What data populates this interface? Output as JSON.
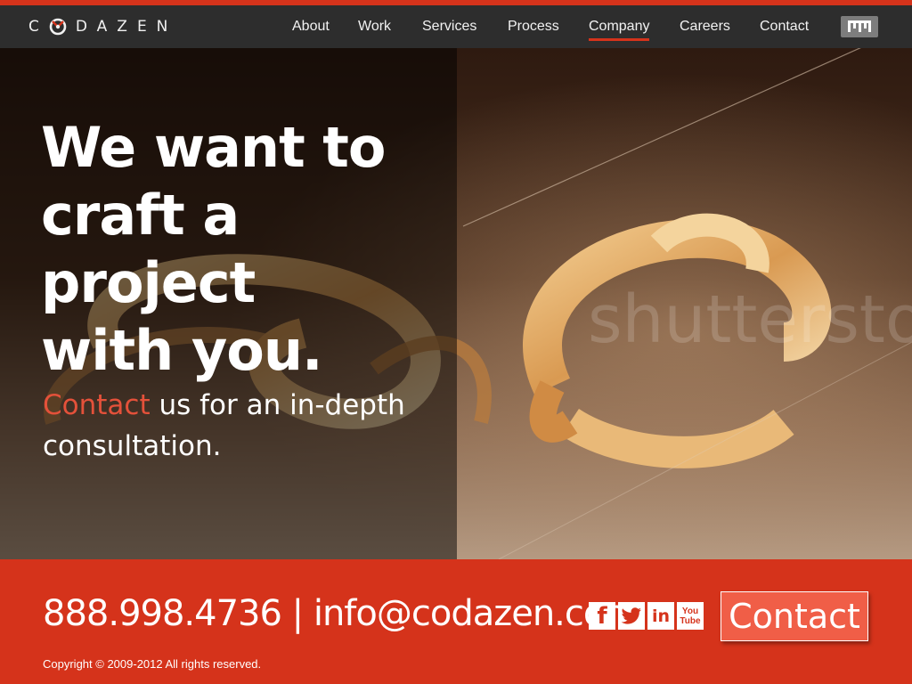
{
  "brand": {
    "name": "CODAZEN",
    "name_after_mark": "DAZEN",
    "name_before_mark": "C",
    "accent": "#d5331b"
  },
  "nav": {
    "items": [
      {
        "label": "About"
      },
      {
        "label": "Work"
      },
      {
        "label": "Services"
      },
      {
        "label": "Process"
      },
      {
        "label": "Company",
        "active": true
      },
      {
        "label": "Careers"
      },
      {
        "label": "Contact"
      }
    ],
    "badge_icon": "comb-icon"
  },
  "hero": {
    "headline_lines": [
      "We want to",
      "craft a project",
      "with you."
    ],
    "sub_accent": "Contact",
    "sub_rest": " us for an in-depth consultation.",
    "watermark": "shutterstock"
  },
  "footer": {
    "phone": "888.998.4736",
    "separator": " | ",
    "email": "info@codazen.com",
    "social": [
      {
        "icon": "facebook-icon",
        "glyph": "f"
      },
      {
        "icon": "twitter-icon",
        "glyph": "🐦"
      },
      {
        "icon": "linkedin-icon",
        "glyph": "in"
      },
      {
        "icon": "youtube-icon",
        "glyph": "You\nTube"
      }
    ],
    "contact_button": "Contact",
    "copyright": "Copyright © 2009-2012  All rights reserved."
  }
}
